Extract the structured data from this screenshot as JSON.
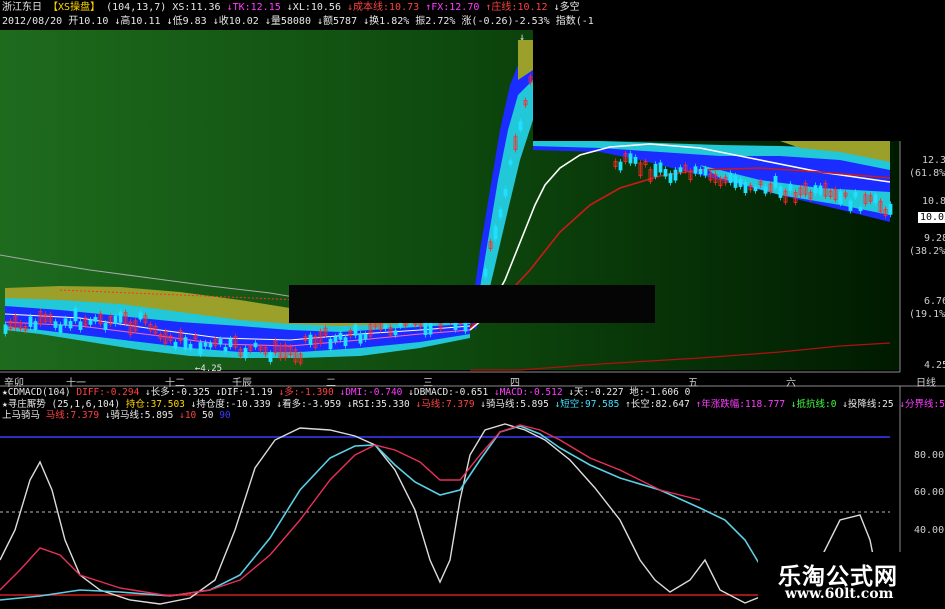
{
  "header": {
    "line1": {
      "name": "浙江东日",
      "indicator": "【XS操盘】",
      "params": "(104,13,7)",
      "xs": "XS:11.36",
      "tk": "↓TK:12.15",
      "xl": "↓XL:10.56",
      "cost": "↓成本线:10.73",
      "fx": "↑FX:12.70",
      "zhuang": "↑庄线:10.12",
      "tail": "↓多空"
    },
    "line2": {
      "date": "2012/08/20",
      "open": "开10.10",
      "high": "↓高10.11",
      "low": "↓低9.83",
      "close": "↓收10.02",
      "vol": "↓量58080",
      "amount": "↓额5787",
      "turnover": "↓换1.82%",
      "amp": "振2.72%",
      "chg": "涨(-0.26)-2.53%",
      "idx": "指数(-1"
    }
  },
  "price_axis": {
    "labels": [
      "12.38",
      "(61.8%)",
      "10.83",
      "10.02",
      "9.28",
      "(38.2%)",
      "6.76",
      "(19.1%)",
      "4.25"
    ]
  },
  "chart_marks": {
    "peak": "↓",
    "low": "←4.25"
  },
  "time_axis": {
    "labels": [
      "辛卯",
      "十一",
      "十二",
      "壬辰",
      "二",
      "三",
      "四",
      "五",
      "六"
    ],
    "period": "日线"
  },
  "indicator_rows": {
    "row1": {
      "name": "★CDMACD(104)",
      "diff": "DIFF:-0.294",
      "changduo": "↓长多:-0.325",
      "dif": "↓DIF:-1.19",
      "duo": "↓多:-1.390",
      "dmi": "↓DMI:-0.740",
      "dbmacd": "↓DBMACD:-0.651",
      "macd": "↓MACD:-0.512",
      "tian": "↓天:-0.227",
      "di": "地:-1.606",
      "zero": "0"
    },
    "row2": {
      "name": "★寻庄厮势",
      "params": "(25,1,6,104)",
      "chicang": "持仓:37.503",
      "chicangdu": "↓持仓度:-10.339",
      "kanduo": "↓看多:-3.959",
      "rsi": "↓RSI:35.330",
      "mx": "↓马线:7.379",
      "qmx": "↓骑马线:5.895",
      "duankong": "↓短空:97.585",
      "changkong": "↑长空:82.647",
      "nianyi": "↑年涨跌幅:118.777",
      "dikang": "↓抵抗线:0",
      "tongjiang": "↓投降线:25",
      "fenjie": "↓分界线:50"
    },
    "row3": {
      "name": "上马骑马",
      "mx": "马线:7.379",
      "qmx": "↓骑马线:5.895",
      "n10": "↓10",
      "n50": "50",
      "n90": "90"
    }
  },
  "osc_axis": {
    "labels": [
      "80.00",
      "60.00",
      "40.00"
    ]
  },
  "watermark": {
    "title": "乐淘公式网",
    "url": "www.60lt.com"
  },
  "colors": {
    "chart_bg": "#0b3d0b",
    "chart_bg_light": "#1d6a1d",
    "up": "#ff2a2a",
    "down": "#20e0ff",
    "band_blue": "#1a2cff",
    "band_cyan": "#22c8d8",
    "band_olive": "#9aa02a",
    "ma_white": "#ffffff",
    "ma_red": "#d01818",
    "osc_white": "#dcdcdc",
    "osc_cyan": "#5bd0e6",
    "osc_red": "#e8305a",
    "line_blue": "#3a3aff"
  }
}
